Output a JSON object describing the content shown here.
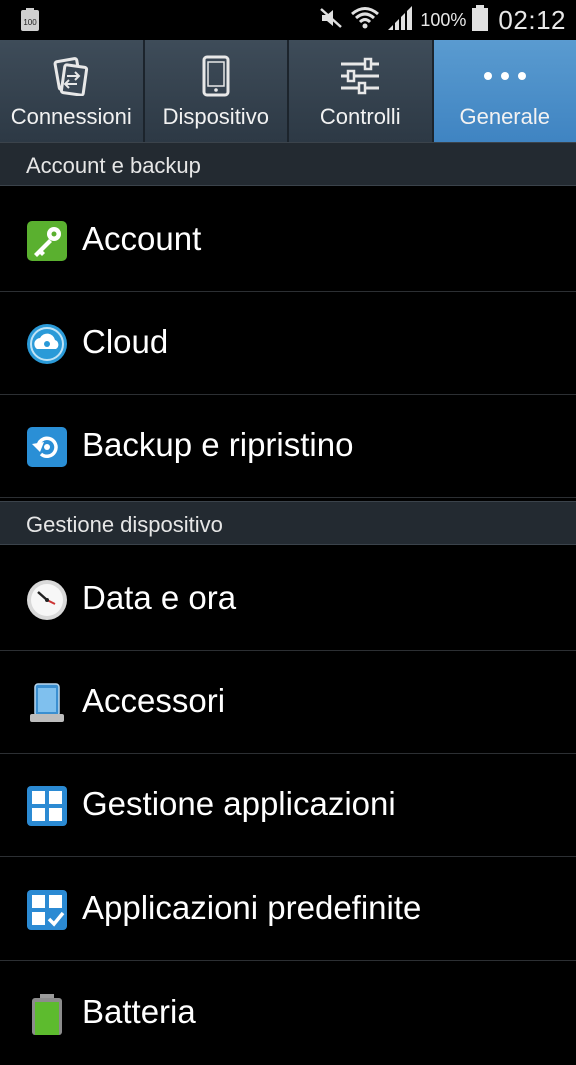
{
  "status_bar": {
    "left_icon": "battery-100-notification-icon",
    "left_icon_text": "100",
    "icons": [
      "mute-icon",
      "wifi-icon",
      "signal-icon",
      "battery-icon"
    ],
    "battery_percent": "100%",
    "time": "02:12"
  },
  "tabs": [
    {
      "label": "Connessioni",
      "icon": "connections-icon",
      "active": false
    },
    {
      "label": "Dispositivo",
      "icon": "device-icon",
      "active": false
    },
    {
      "label": "Controlli",
      "icon": "sliders-icon",
      "active": false
    },
    {
      "label": "Generale",
      "icon": "more-dots-icon",
      "active": true
    }
  ],
  "sections": [
    {
      "title": "Account e backup",
      "items": [
        {
          "label": "Account",
          "icon": "key-icon"
        },
        {
          "label": "Cloud",
          "icon": "cloud-icon"
        },
        {
          "label": "Backup e ripristino",
          "icon": "backup-restore-icon"
        }
      ]
    },
    {
      "title": "Gestione dispositivo",
      "items": [
        {
          "label": "Data e ora",
          "icon": "clock-icon"
        },
        {
          "label": "Accessori",
          "icon": "accessories-icon"
        },
        {
          "label": "Gestione applicazioni",
          "icon": "app-manager-icon"
        },
        {
          "label": "Applicazioni predefinite",
          "icon": "default-apps-icon"
        },
        {
          "label": "Batteria",
          "icon": "battery-icon"
        }
      ]
    }
  ],
  "colors": {
    "active_tab": "#4a8fc8",
    "tab_bg": "#3a4754",
    "section_bg": "#232a31"
  }
}
